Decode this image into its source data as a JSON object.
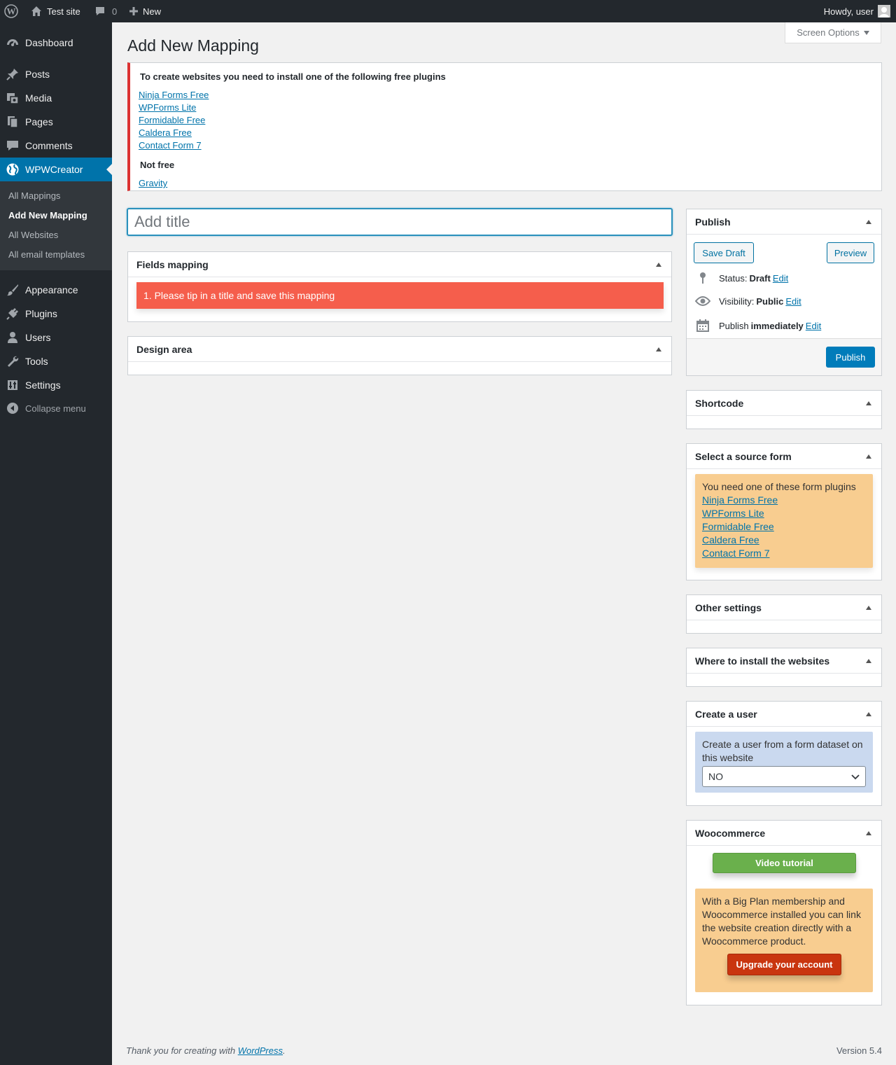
{
  "adminbar": {
    "site_name": "Test site",
    "comments_count": "0",
    "new_label": "New",
    "greeting": "Howdy, user"
  },
  "sidebar": {
    "items": [
      {
        "label": "Dashboard",
        "icon": "dashboard-icon"
      },
      {
        "label": "Posts",
        "icon": "pushpin-icon"
      },
      {
        "label": "Media",
        "icon": "media-icon"
      },
      {
        "label": "Pages",
        "icon": "pages-icon"
      },
      {
        "label": "Comments",
        "icon": "comment-icon"
      },
      {
        "label": "WPWCreator",
        "icon": "globe-icon"
      },
      {
        "label": "Appearance",
        "icon": "brush-icon"
      },
      {
        "label": "Plugins",
        "icon": "plug-icon"
      },
      {
        "label": "Users",
        "icon": "user-icon"
      },
      {
        "label": "Tools",
        "icon": "wrench-icon"
      },
      {
        "label": "Settings",
        "icon": "settings-icon"
      }
    ],
    "submenu": [
      "All Mappings",
      "Add New Mapping",
      "All Websites",
      "All email templates"
    ],
    "collapse_label": "Collapse menu"
  },
  "screen_options": "Screen Options",
  "page_title": "Add New Mapping",
  "notice": {
    "title": "To create websites you need to install one of the following free plugins",
    "free_links": [
      "Ninja Forms Free",
      "WPForms Lite",
      "Formidable Free",
      "Caldera Free",
      "Contact Form 7"
    ],
    "not_free_label": "Not free",
    "paid_links": [
      "Gravity"
    ]
  },
  "title_input": {
    "placeholder": "Add title",
    "value": ""
  },
  "fields_mapping": {
    "heading": "Fields mapping",
    "alert": "1. Please tip in a title and save this mapping"
  },
  "design_area": {
    "heading": "Design area"
  },
  "publish": {
    "heading": "Publish",
    "save_draft": "Save Draft",
    "preview": "Preview",
    "status_label": "Status:",
    "status_value": "Draft",
    "visibility_label": "Visibility:",
    "visibility_value": "Public",
    "publish_label": "Publish",
    "publish_value": "immediately",
    "edit_label": "Edit",
    "publish_button": "Publish"
  },
  "shortcode": {
    "heading": "Shortcode"
  },
  "source_form": {
    "heading": "Select a source form",
    "intro": "You need one of these form plugins",
    "links": [
      "Ninja Forms Free",
      "WPForms Lite",
      "Formidable Free",
      "Caldera Free",
      "Contact Form 7"
    ]
  },
  "other_settings": {
    "heading": "Other settings"
  },
  "install_websites": {
    "heading": "Where to install the websites"
  },
  "create_user": {
    "heading": "Create a user",
    "text": "Create a user from a form dataset on this website",
    "select_value": "NO"
  },
  "woocommerce": {
    "heading": "Woocommerce",
    "video_button": "Video tutorial",
    "text": "With a Big Plan membership and Woocommerce installed you can link the website creation directly with a Woocommerce product.",
    "upgrade_button": "Upgrade your account"
  },
  "footer": {
    "thanks_prefix": "Thank you for creating with",
    "thanks_link": "WordPress",
    "thanks_suffix": ".",
    "version": "Version 5.4"
  },
  "colors": {
    "adminbar_bg": "#23282d",
    "accent": "#0073aa",
    "notice_error": "#dc3232",
    "alert_bg": "#f55e4c",
    "warning_box": "#f8cd90",
    "info_box": "#cad9ef",
    "video_button": "#6ab04c",
    "upgrade_button": "#c9350f"
  }
}
